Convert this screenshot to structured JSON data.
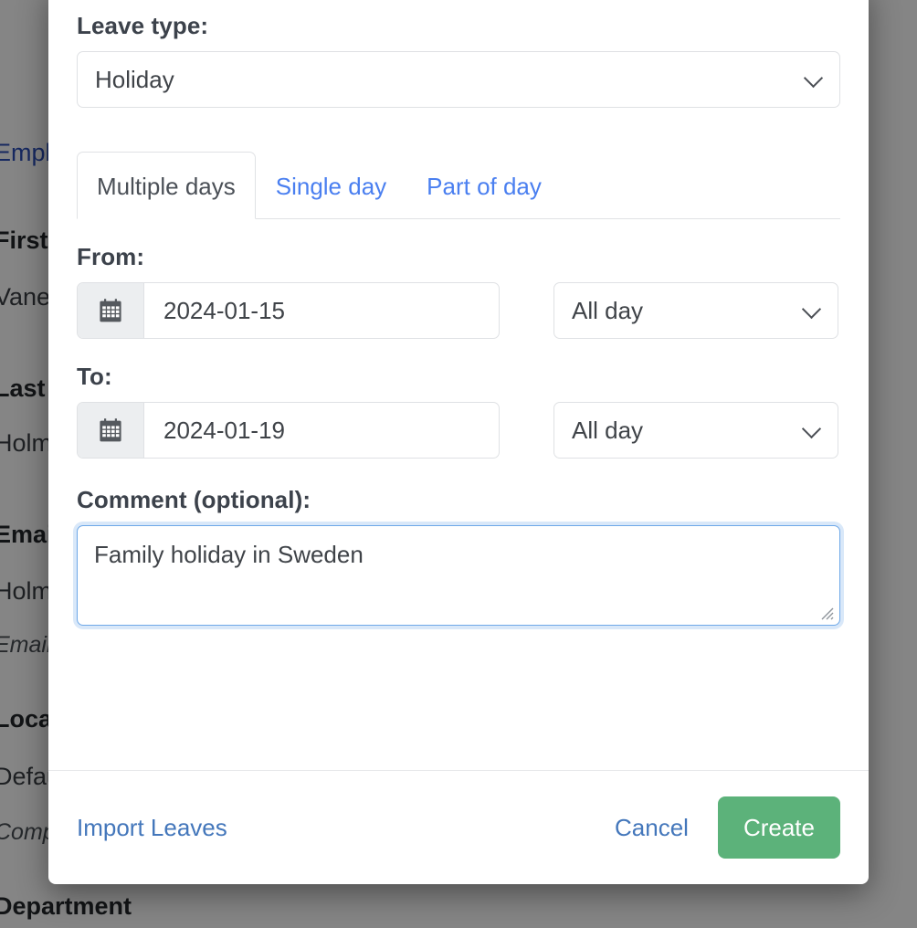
{
  "background": {
    "link_text": "Employee",
    "rows": [
      {
        "label": "First Name",
        "value": "Vanessa"
      },
      {
        "label": "Last Name",
        "value": "Holmes"
      },
      {
        "label": "Email Address",
        "value": "Email address",
        "hint": true
      },
      {
        "label": "Location",
        "value": "Default"
      },
      {
        "label": "Company",
        "value": "Company",
        "hint": true
      },
      {
        "label": "Department",
        "value": ""
      }
    ]
  },
  "modal": {
    "leave_type": {
      "label": "Leave type:",
      "value": "Holiday",
      "chevron_icon": "chevron-down-icon"
    },
    "tabs": [
      {
        "label": "Multiple days",
        "active": true
      },
      {
        "label": "Single day",
        "active": false
      },
      {
        "label": "Part of day",
        "active": false
      }
    ],
    "from": {
      "label": "From:",
      "date_value": "2024-01-15",
      "calendar_icon": "calendar-icon",
      "day_part": "All day"
    },
    "to": {
      "label": "To:",
      "date_value": "2024-01-19",
      "calendar_icon": "calendar-icon",
      "day_part": "All day"
    },
    "comment": {
      "label": "Comment (optional):",
      "value": "Family holiday in Sweden",
      "placeholder": "",
      "resize_icon": "resize-grip-icon"
    },
    "footer": {
      "import_label": "Import Leaves",
      "cancel_label": "Cancel",
      "create_label": "Create"
    }
  },
  "colors": {
    "link_blue": "#4a7ff0",
    "footer_link_blue": "#4477bb",
    "create_green": "#5cb27a",
    "label_dark": "#3c424b",
    "focus_border": "#6ea8e8"
  }
}
